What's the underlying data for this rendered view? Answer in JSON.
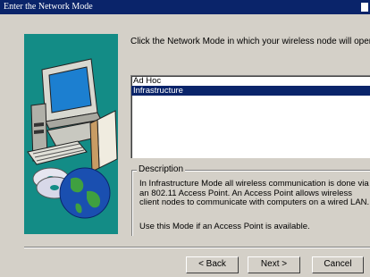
{
  "window": {
    "title": "Enter the Network Mode"
  },
  "instruction": "Click the Network Mode in which your wireless node will operate.",
  "modes": [
    "Ad Hoc",
    "Infrastructure"
  ],
  "selected_mode": "Infrastructure",
  "description": {
    "label": "Description",
    "text": "In Infrastructure Mode all wireless communication is done via an 802.11 Access Point.  An Access Point allows wireless client nodes to communicate with computers on a wired LAN.",
    "note": "Use this Mode if an Access Point is available."
  },
  "buttons": {
    "back": "< Back",
    "next": "Next >",
    "cancel": "Cancel"
  },
  "colors": {
    "titlebar": "#0a246a",
    "art_background": "#138c86",
    "dialog": "#d4d0c8"
  },
  "icons": [
    "computer-icon",
    "cd-icon",
    "globe-icon"
  ]
}
